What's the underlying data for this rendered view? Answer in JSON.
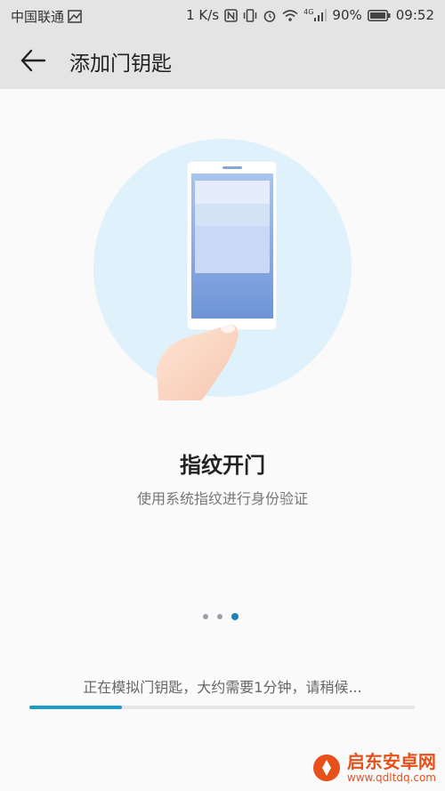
{
  "status_bar": {
    "carrier": "中国联通",
    "speed": "1 K/s",
    "network": "4G",
    "battery": "90%",
    "time": "09:52"
  },
  "app_bar": {
    "title": "添加门钥匙"
  },
  "main": {
    "headline": "指纹开门",
    "subtitle": "使用系统指纹进行身份验证"
  },
  "pager": {
    "count": 3,
    "active_index": 2
  },
  "progress": {
    "text": "正在模拟门钥匙，大约需要1分钟，请稍候...",
    "value": 0.24
  },
  "watermark": {
    "name": "启东安卓网",
    "url": "www.qdltdq.com"
  },
  "colors": {
    "accent": "#1b9bc9",
    "bar_bg": "#e4e4e4",
    "circle_bg": "#dff1fb"
  }
}
